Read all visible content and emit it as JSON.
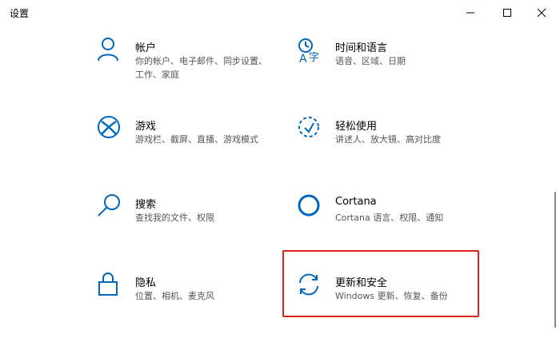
{
  "window": {
    "title": "设置",
    "minimize_icon": "minimize-icon",
    "maximize_icon": "maximize-icon",
    "close_icon": "close-icon"
  },
  "tiles": [
    {
      "label": "帐户",
      "desc": "你的帐户、电子邮件、同步设置、工作、家庭",
      "icon": "person-icon"
    },
    {
      "label": "时间和语言",
      "desc": "语音、区域、日期",
      "icon": "time-language-icon"
    },
    {
      "label": "游戏",
      "desc": "游戏栏、截屏、直播、游戏模式",
      "icon": "xbox-icon"
    },
    {
      "label": "轻松使用",
      "desc": "讲述人、放大镜、高对比度",
      "icon": "ease-of-access-icon"
    },
    {
      "label": "搜索",
      "desc": "查找我的文件、权限",
      "icon": "search-icon"
    },
    {
      "label": "Cortana",
      "desc": "Cortana 语言、权限、通知",
      "icon": "cortana-icon"
    },
    {
      "label": "隐私",
      "desc": "位置、相机、麦克风",
      "icon": "lock-icon"
    },
    {
      "label": "更新和安全",
      "desc": "Windows 更新、恢复、备份",
      "icon": "sync-icon"
    }
  ],
  "accent_color": "#0067c0",
  "highlight_color": "#e0201b"
}
